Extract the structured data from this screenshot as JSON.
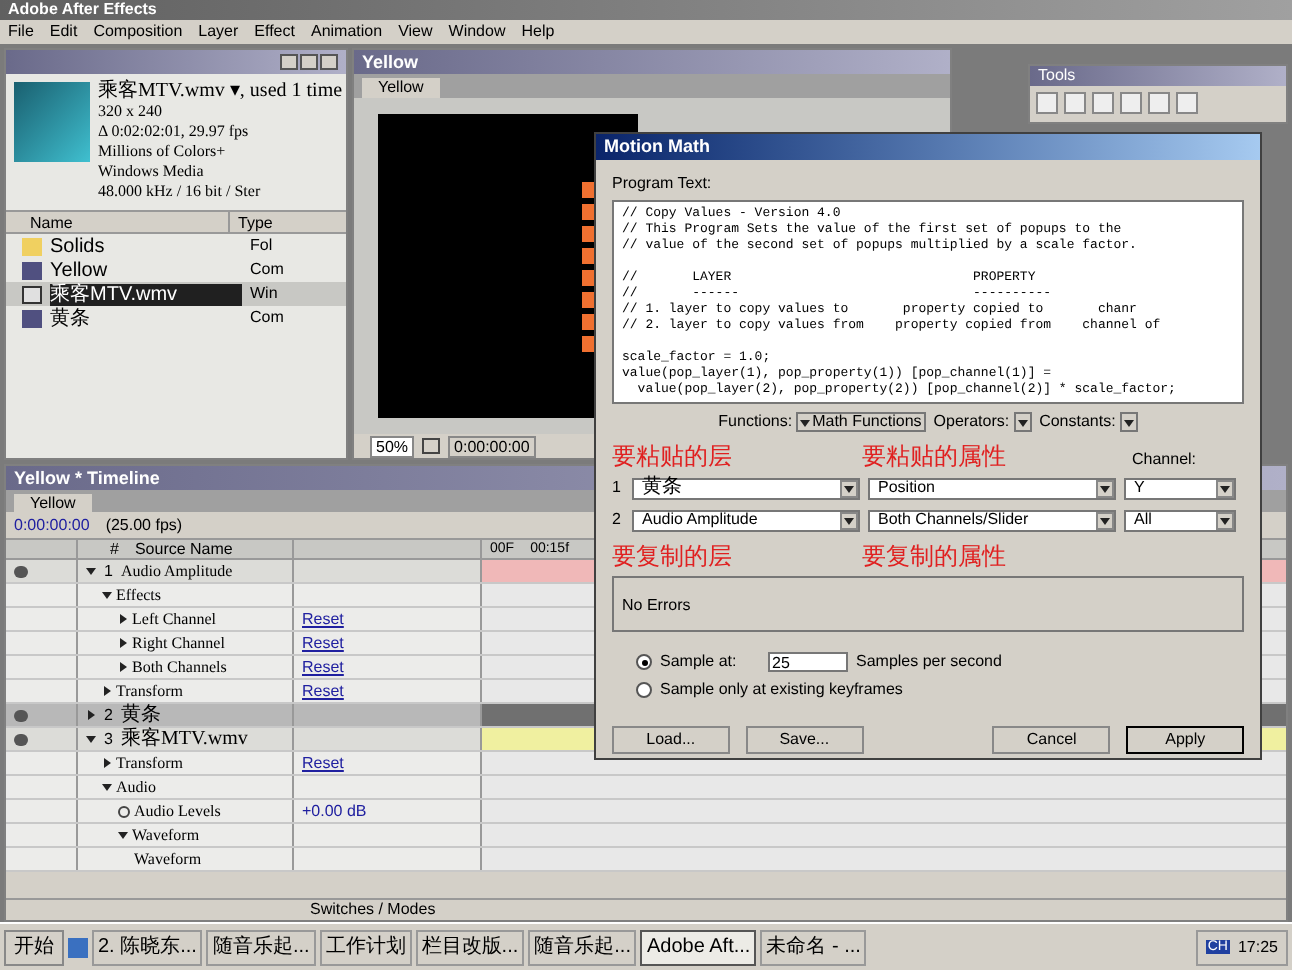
{
  "window": {
    "title": "Adobe After Effects"
  },
  "menu": [
    "File",
    "Edit",
    "Composition",
    "Layer",
    "Effect",
    "Animation",
    "View",
    "Window",
    "Help"
  ],
  "project": {
    "info": [
      "乘客MTV.wmv ▾, used 1 time",
      "320 x 240",
      "Δ 0:02:02:01, 29.97 fps",
      "Millions of Colors+",
      "Windows Media",
      "48.000 kHz / 16 bit / Ster"
    ],
    "columns": [
      "Name",
      "Type"
    ],
    "items": [
      {
        "name": "Solids",
        "type": "Fol",
        "kind": "folder",
        "selected": false
      },
      {
        "name": "Yellow",
        "type": "Com",
        "kind": "comp",
        "selected": false
      },
      {
        "name": "乘客MTV.wmv",
        "type": "Win",
        "kind": "video",
        "selected": true
      },
      {
        "name": "黄条",
        "type": "Com",
        "kind": "comp",
        "selected": false
      }
    ]
  },
  "comp": {
    "title": "Yellow",
    "tab": "Yellow",
    "zoom": "50%",
    "time": "0:00:00:00"
  },
  "tools": {
    "title": "Tools"
  },
  "timeline": {
    "title": "Yellow * Timeline",
    "tab": "Yellow",
    "time": "0:00:00:00",
    "fps": "(25.00 fps)",
    "columns": [
      "#",
      "Source Name"
    ],
    "ruler": [
      "00F",
      "00:15f"
    ],
    "rows": [
      {
        "kind": "layer",
        "num": "1",
        "name": "Audio Amplitude",
        "selected": false,
        "children": [
          {
            "kind": "group",
            "name": "Effects",
            "children": [
              {
                "kind": "prop",
                "name": "Left Channel",
                "value": "Reset"
              },
              {
                "kind": "prop",
                "name": "Right Channel",
                "value": "Reset"
              },
              {
                "kind": "prop",
                "name": "Both Channels",
                "value": "Reset"
              }
            ]
          },
          {
            "kind": "prop",
            "name": "Transform",
            "value": "Reset"
          }
        ]
      },
      {
        "kind": "layer",
        "num": "2",
        "name": "黄条",
        "selected": true
      },
      {
        "kind": "layer",
        "num": "3",
        "name": "乘客MTV.wmv",
        "selected": false,
        "children": [
          {
            "kind": "prop",
            "name": "Transform",
            "value": "Reset"
          },
          {
            "kind": "group",
            "name": "Audio",
            "children": [
              {
                "kind": "value",
                "name": "Audio Levels",
                "value": "+0.00 dB"
              },
              {
                "kind": "group",
                "name": "Waveform",
                "children": [
                  {
                    "kind": "wave",
                    "name": "Waveform"
                  }
                ]
              }
            ]
          }
        ]
      }
    ],
    "footer": "Switches / Modes"
  },
  "dialog": {
    "title": "Motion Math",
    "program_label": "Program Text:",
    "code": [
      [
        "// Copy Values - Version 4.0",
        "// This Program Sets the value of the first set of popups to the",
        "// value of the second set of popups multiplied by a scale factor."
      ],
      [
        "//       LAYER                               PROPERTY",
        "//       ------                              ----------",
        "// 1. layer to copy values to       property copied to       chanr",
        "// 2. layer to copy values from    property copied from    channel of"
      ],
      [
        "scale_factor = 1.0;",
        "value(pop_layer(1), pop_property(1)) [pop_channel(1)] =",
        "  value(pop_layer(2), pop_property(2)) [pop_channel(2)] * scale_factor;"
      ]
    ],
    "menus": [
      {
        "label": "Functions:",
        "value": "Math Functions"
      },
      {
        "label": "Operators:"
      },
      {
        "label": "Constants:"
      }
    ],
    "channel_label": "Channel:",
    "rows": [
      {
        "num": "1",
        "layer": "黄条",
        "property": "Position",
        "channel": "Y"
      },
      {
        "num": "2",
        "layer": "Audio Amplitude",
        "property": "Both Channels/Slider",
        "channel": "All"
      }
    ],
    "annotations_top": [
      "要粘贴的层",
      "要粘贴的属性"
    ],
    "annotations_bottom": [
      "要复制的层",
      "要复制的属性"
    ],
    "messages": "No Errors",
    "sample_options": [
      {
        "label": "Sample at:",
        "selected": true,
        "value": "25",
        "suffix": "Samples per second"
      },
      {
        "label": "Sample only at existing keyframes",
        "selected": false
      }
    ],
    "buttons": [
      "Load...",
      "Save...",
      "Cancel",
      "Apply"
    ]
  },
  "taskbar": {
    "start": "开始",
    "tasks": [
      {
        "label": "2. 陈晓东...",
        "selected": false
      },
      {
        "label": "随音乐起...",
        "selected": false
      },
      {
        "label": "工作计划",
        "selected": false
      },
      {
        "label": "栏目改版...",
        "selected": false
      },
      {
        "label": "随音乐起...",
        "selected": false
      },
      {
        "label": "Adobe Aft...",
        "selected": true
      },
      {
        "label": "未命名 - ...",
        "selected": false
      }
    ],
    "lang": "CH",
    "clock": "17:25"
  }
}
